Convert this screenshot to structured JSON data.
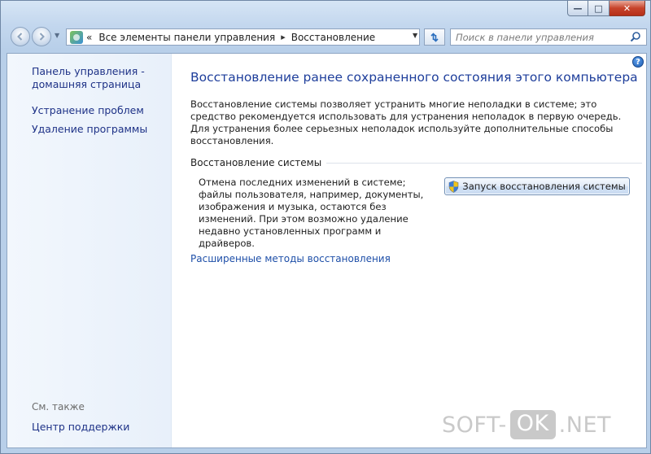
{
  "window": {
    "minimize_glyph": "—",
    "maximize_glyph": "□",
    "close_glyph": "✕"
  },
  "nav": {
    "breadcrumb_lead": "«",
    "breadcrumb": [
      "Все элементы панели управления",
      "Восстановление"
    ],
    "search_placeholder": "Поиск в панели управления"
  },
  "sidebar": {
    "home_line1": "Панель управления -",
    "home_line2": "домашняя страница",
    "troubleshoot": "Устранение проблем",
    "uninstall": "Удаление программы",
    "see_also": "См. также",
    "support_center": "Центр поддержки"
  },
  "main": {
    "title": "Восстановление ранее сохраненного состояния этого компьютера",
    "intro": "Восстановление системы позволяет устранить многие неполадки в системе; это средство рекомендуется использовать для устранения неполадок в первую очередь. Для устранения более серьезных неполадок используйте дополнительные способы восстановления.",
    "section_title": "Восстановление системы",
    "restore_description": "Отмена последних изменений в системе; файлы пользователя, например, документы, изображения и музыка, остаются без изменений. При этом возможно удаление недавно установленных программ и драйверов.",
    "restore_button": "Запуск восстановления системы",
    "advanced_link": "Расширенные методы восстановления",
    "help_glyph": "?"
  },
  "watermark": {
    "left": "SOFT-",
    "box": "OK",
    "right": ".NET"
  },
  "colors": {
    "link": "#1e3287",
    "title": "#1e3e9b",
    "close_button": "#c7432b"
  }
}
